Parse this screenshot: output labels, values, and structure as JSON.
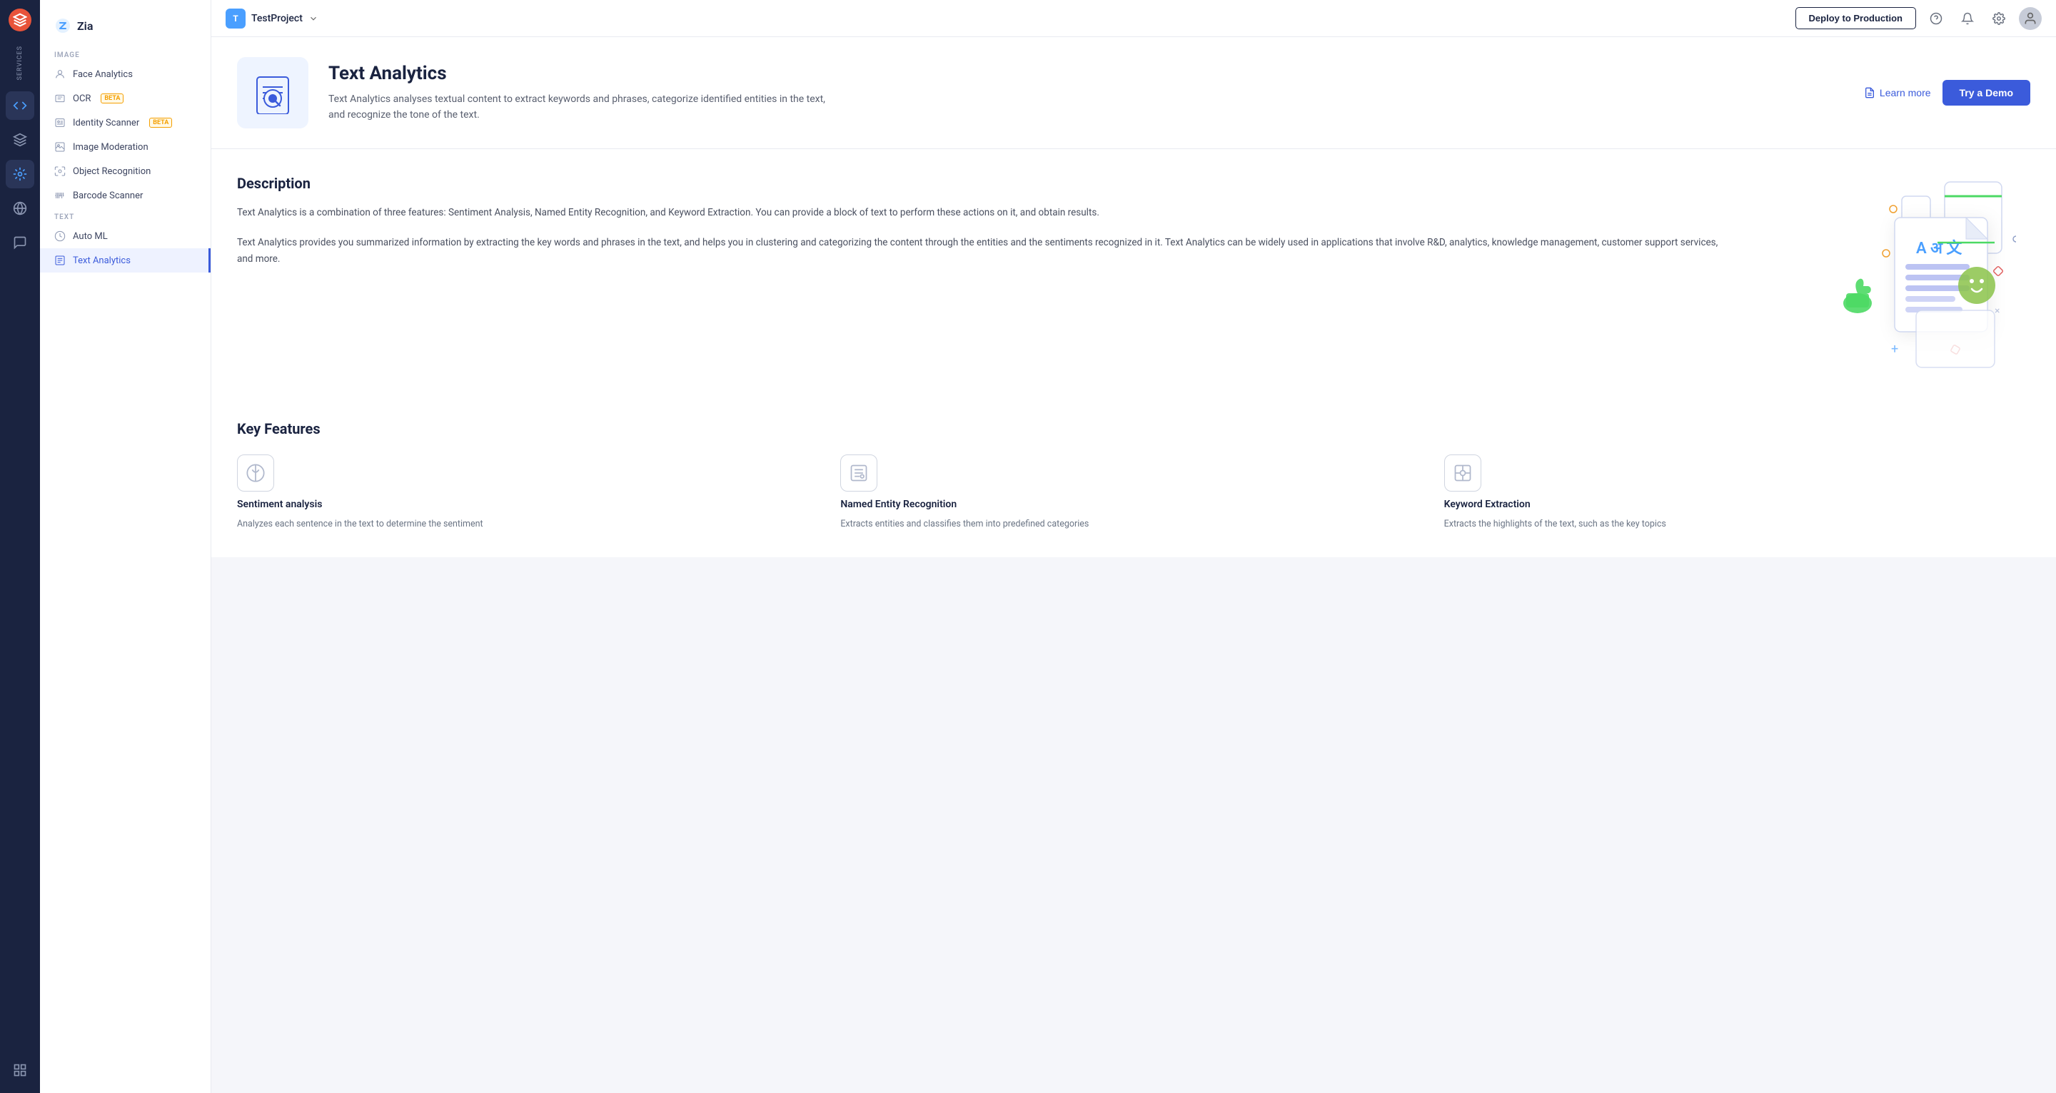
{
  "rail": {
    "services_label": "Services"
  },
  "sidebar": {
    "zia_label": "Zia",
    "image_section": "IMAGE",
    "text_section": "TEXT",
    "items": [
      {
        "id": "face-analytics",
        "label": "Face Analytics",
        "active": false
      },
      {
        "id": "ocr",
        "label": "OCR",
        "active": false,
        "beta": true
      },
      {
        "id": "identity-scanner",
        "label": "Identity Scanner",
        "active": false,
        "beta": true
      },
      {
        "id": "image-moderation",
        "label": "Image Moderation",
        "active": false
      },
      {
        "id": "object-recognition",
        "label": "Object Recognition",
        "active": false
      },
      {
        "id": "barcode-scanner",
        "label": "Barcode Scanner",
        "active": false
      },
      {
        "id": "auto-ml",
        "label": "Auto ML",
        "active": false
      },
      {
        "id": "text-analytics",
        "label": "Text Analytics",
        "active": true
      }
    ]
  },
  "topbar": {
    "project_initial": "T",
    "project_name": "TestProject",
    "deploy_btn": "Deploy to Production"
  },
  "hero": {
    "title": "Text Analytics",
    "description": "Text Analytics analyses textual content to extract keywords and phrases, categorize identified entities in the text, and recognize the tone of the text.",
    "learn_more": "Learn more",
    "try_demo": "Try a Demo"
  },
  "description": {
    "title": "Description",
    "para1": "Text Analytics is a combination of three features: Sentiment Analysis, Named Entity Recognition, and Keyword Extraction. You can provide a block of text to perform these actions on it, and obtain results.",
    "para2": "Text Analytics provides you summarized information by extracting the key words and phrases in the text, and helps you in clustering and categorizing the content through the entities and the sentiments recognized in it. Text Analytics can be widely used in applications that involve R&D, analytics, knowledge management, customer support services, and more."
  },
  "key_features": {
    "title": "Key Features",
    "features": [
      {
        "name": "Sentiment analysis",
        "desc": "Analyzes each sentence in the text to determine the sentiment"
      },
      {
        "name": "Named Entity Recognition",
        "desc": "Extracts entities and classifies them into predefined categories"
      },
      {
        "name": "Keyword Extraction",
        "desc": "Extracts the highlights of the text, such as the key topics"
      }
    ]
  }
}
